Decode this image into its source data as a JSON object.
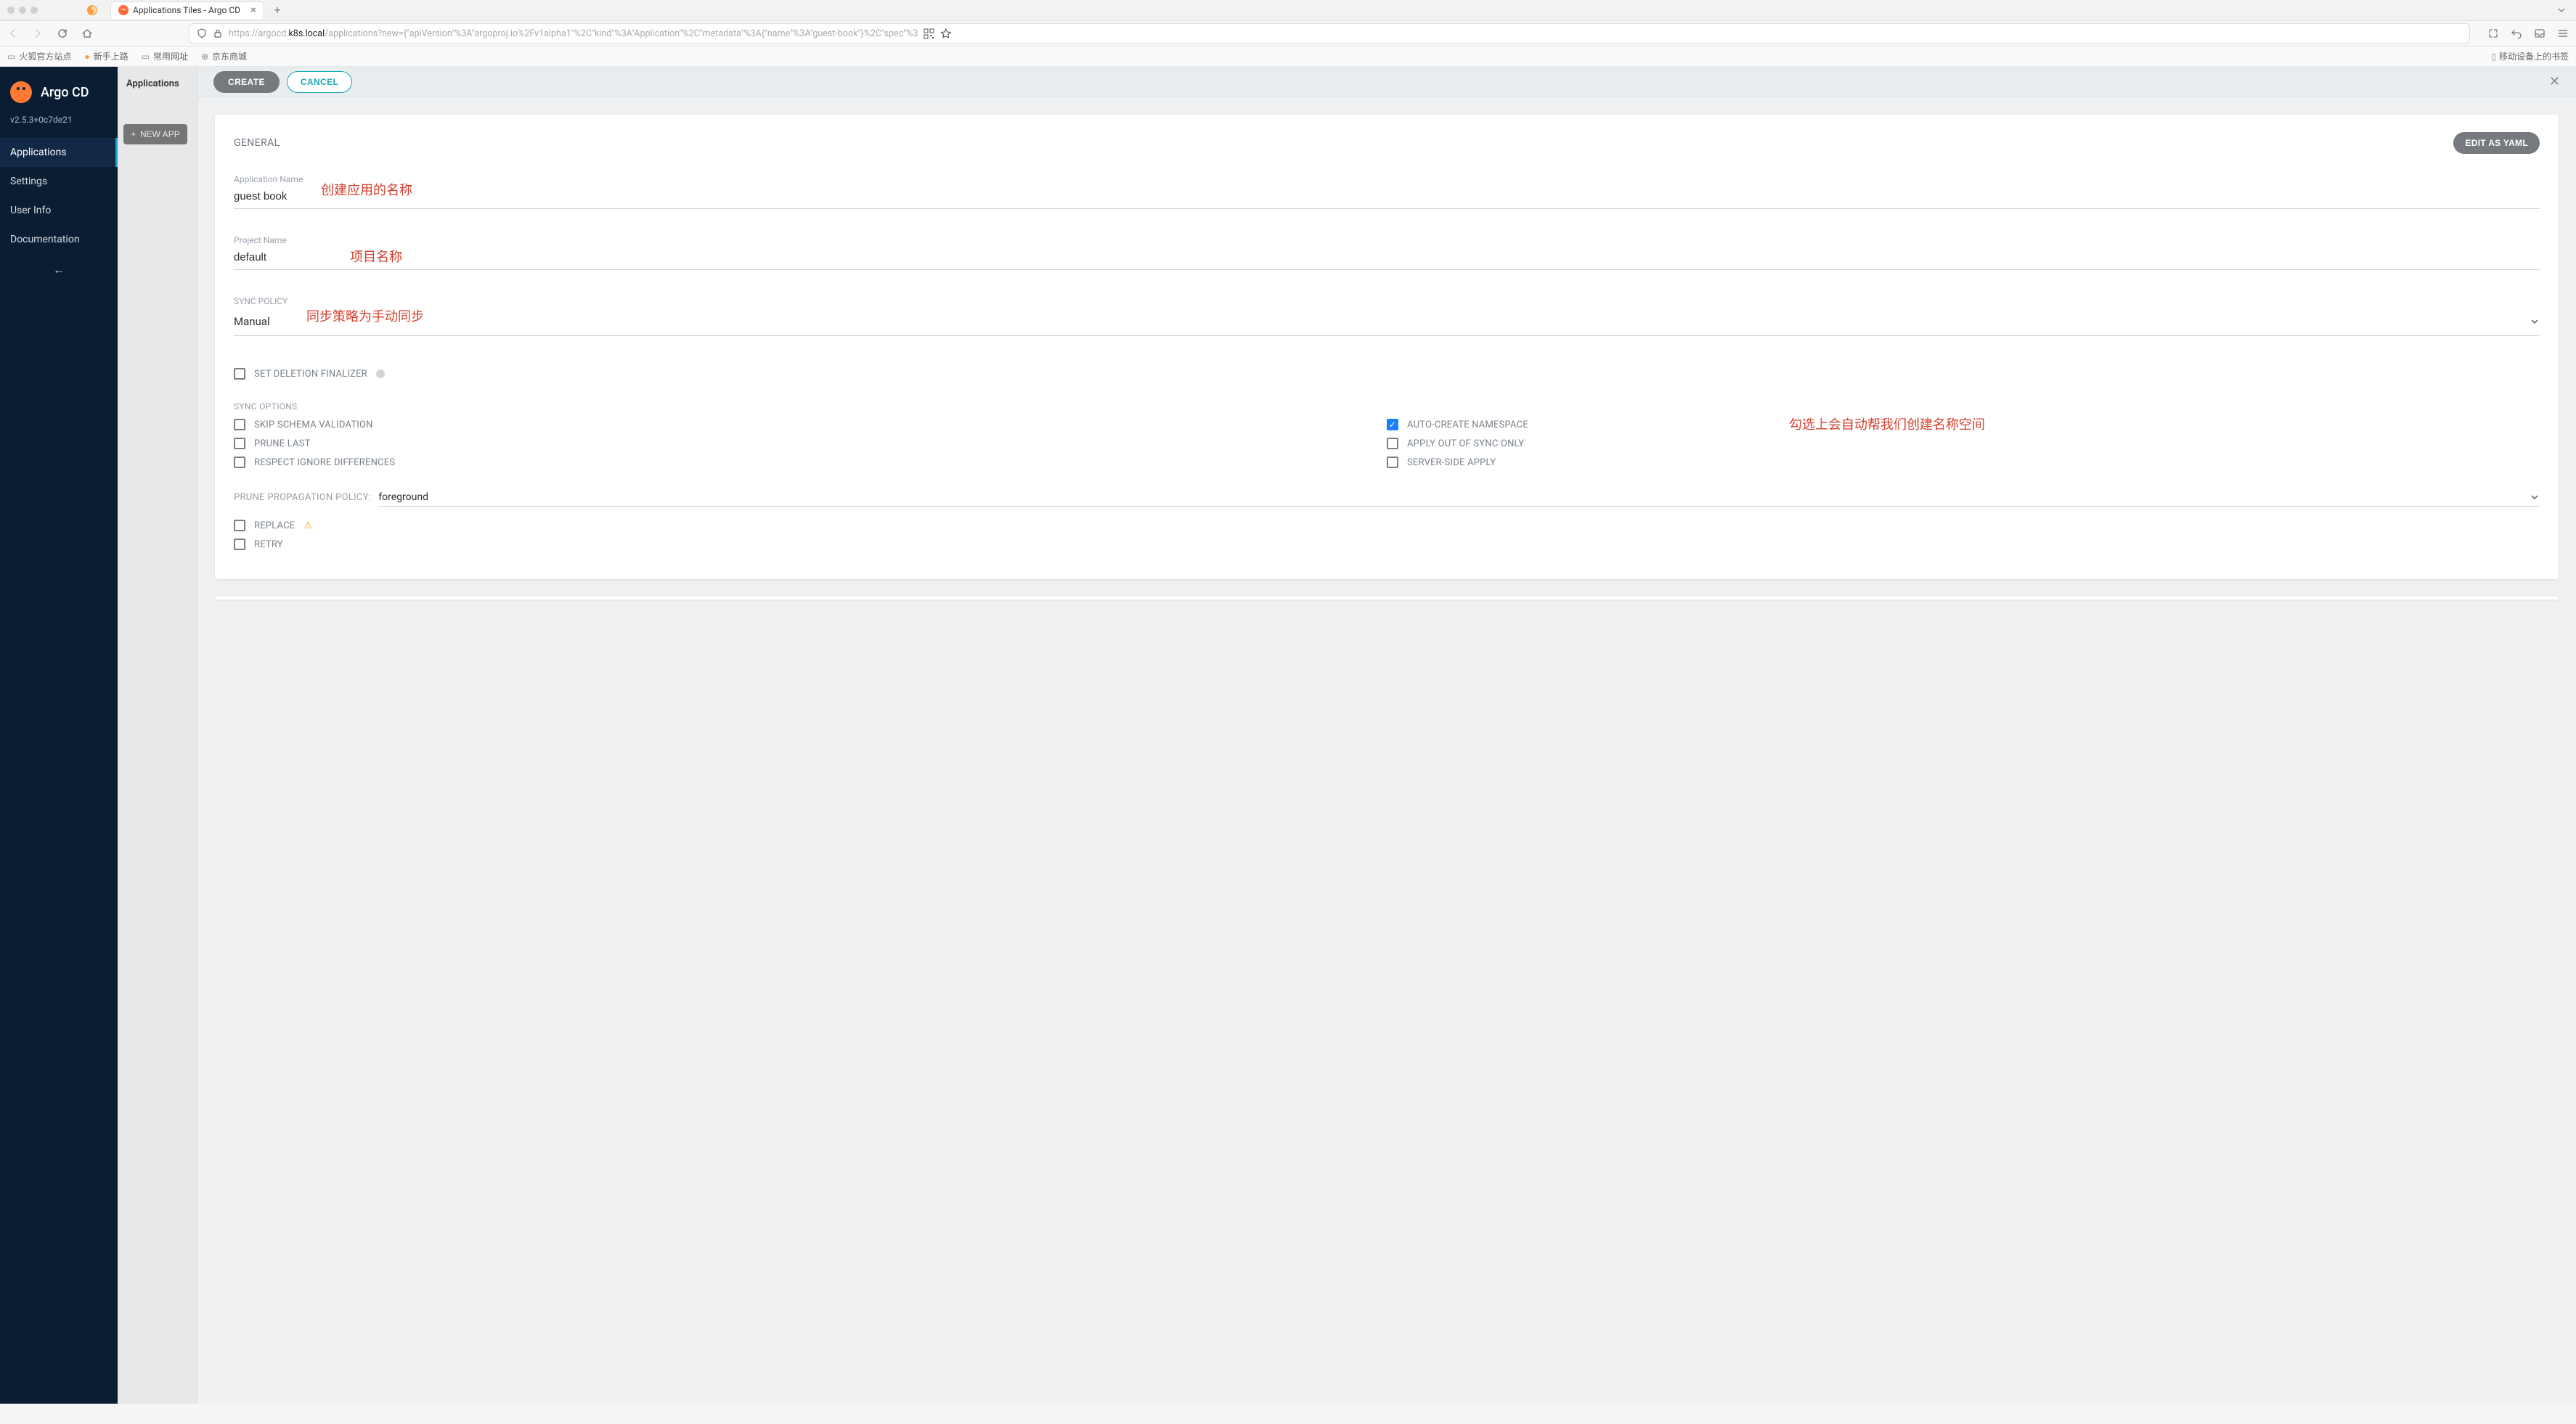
{
  "browser": {
    "tab_title": "Applications Tiles - Argo CD",
    "url_pre": "https://argocd.",
    "url_host": "k8s.local",
    "url_path": "/applications?new={\"apiVersion\"%3A\"argoproj.io%2Fv1alpha1\"%2C\"kind\"%3A\"Application\"%2C\"metadata\"%3A{\"name\"%3A\"guest-book\"}%2C\"spec\"%3",
    "bookmarks": [
      "火狐官方站点",
      "新手上路",
      "常用网址",
      "京东商城"
    ],
    "mobile_bm": "移动设备上的书签"
  },
  "sidebar": {
    "brand": "Argo CD",
    "version": "v2.5.3+0c7de21",
    "items": [
      "Applications",
      "Settings",
      "User Info",
      "Documentation"
    ]
  },
  "secondary": {
    "header": "Applications",
    "new_app": "NEW APP"
  },
  "panel": {
    "create": "CREATE",
    "cancel": "CANCEL",
    "edit_yaml": "EDIT AS YAML"
  },
  "form": {
    "general_title": "GENERAL",
    "app_name_label": "Application Name",
    "app_name_value": "guest book",
    "project_label": "Project Name",
    "project_value": "default",
    "sync_policy_label": "SYNC POLICY",
    "sync_policy_value": "Manual",
    "set_del_finalizer": "SET DELETION FINALIZER",
    "sync_options_label": "SYNC OPTIONS",
    "opts_left": [
      "SKIP SCHEMA VALIDATION",
      "PRUNE LAST",
      "RESPECT IGNORE DIFFERENCES"
    ],
    "opts_right": [
      "AUTO-CREATE NAMESPACE",
      "APPLY OUT OF SYNC ONLY",
      "SERVER-SIDE APPLY"
    ],
    "prune_policy_label": "PRUNE PROPAGATION POLICY:",
    "prune_policy_value": "foreground",
    "replace": "REPLACE",
    "retry": "RETRY"
  },
  "annotations": {
    "a1": "创建应用的名称",
    "a2": "项目名称",
    "a3": "同步策略为手动同步",
    "a4": "勾选上会自动帮我们创建名称空间"
  }
}
